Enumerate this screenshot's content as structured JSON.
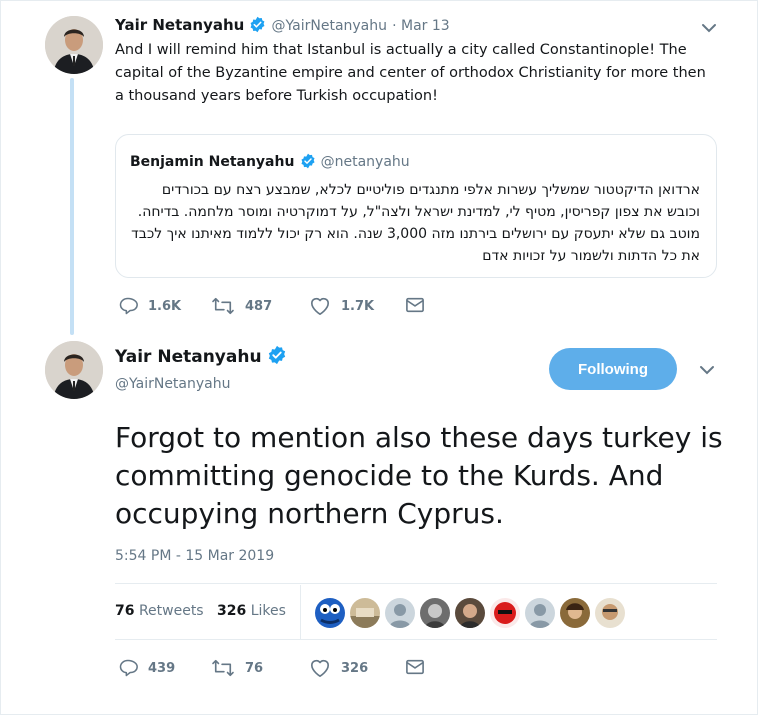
{
  "reply_tweet": {
    "author_name": "Yair Netanyahu",
    "author_handle": "@YairNetanyahu",
    "date": "· Mar 13",
    "text": "And I will remind him that Istanbul is actually a city called Constantinople! The capital of the Byzantine empire and center of orthodox Christianity for more then a thousand years before Turkish occupation!",
    "quote": {
      "author_name": "Benjamin Netanyahu",
      "author_handle": "@netanyahu",
      "text": "ארדואן הדיקטטור שמשליך עשרות אלפי מתנגדים פוליטיים לכלא, שמבצע רצח עם בכורדים וכובש את צפון קפריסין, מטיף לי, למדינת ישראל ולצה\"ל, על דמוקרטיה ומוסר מלחמה. בדיחה. מוטב גם שלא יתעסק עם ירושלים בירתנו מזה 3,000 שנה. הוא רק יכול ללמוד מאיתנו איך לכבד את כל הדתות ולשמור על זכויות אדם"
    },
    "actions": {
      "replies": "1.6K",
      "retweets": "487",
      "likes": "1.7K"
    }
  },
  "main_tweet": {
    "author_name": "Yair Netanyahu",
    "author_handle": "@YairNetanyahu",
    "follow_label": "Following",
    "text": "Forgot to mention also these days turkey is committing genocide to the Kurds. And occupying northern Cyprus.",
    "timestamp": "5:54 PM - 15 Mar 2019",
    "stats": {
      "retweets_count": "76",
      "retweets_label": "Retweets",
      "likes_count": "326",
      "likes_label": "Likes"
    },
    "actions": {
      "replies": "439",
      "retweets": "76",
      "likes": "326"
    }
  },
  "icons": [
    "verified-badge-icon",
    "chevron-down-icon",
    "reply-icon",
    "retweet-icon",
    "like-icon",
    "direct-message-icon"
  ],
  "colors": {
    "accent": "#1da1f2",
    "follow_button": "#5eaeea",
    "thread_line": "#c4e0f5",
    "muted_text": "#657786"
  }
}
